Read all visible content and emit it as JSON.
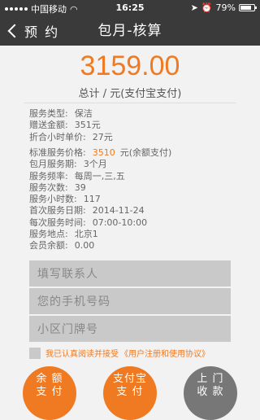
{
  "status_bar": {
    "carrier": "中国移动",
    "time": "16:25",
    "battery_text": "79%",
    "battery_level": 0.79
  },
  "nav": {
    "back_label": "预 约",
    "title": "包月-核算"
  },
  "amount": {
    "value": "3159.00",
    "subtitle": "总计 / 元(支付宝支付)"
  },
  "info_group1": [
    {
      "label": "服务类型:",
      "value": "保洁"
    },
    {
      "label": "赠送金额:",
      "value": "351元"
    },
    {
      "label": "折合小时单价:",
      "value": "27元"
    }
  ],
  "info_group2": [
    {
      "label": "标准服务价格:",
      "value": "3510",
      "suffix": "元(余额支付)"
    },
    {
      "label": "包月服务期:",
      "value": "3个月"
    },
    {
      "label": "服务频率:",
      "value": "每周一,三,五"
    },
    {
      "label": "服务次数:",
      "value": "39"
    },
    {
      "label": "服务小时数:",
      "value": "117"
    },
    {
      "label": "首次服务日期:",
      "value": "2014-11-24"
    },
    {
      "label": "每次服务时间:",
      "value": "07:00-10:00"
    },
    {
      "label": "服务地点:",
      "value": "北京1"
    },
    {
      "label": "会员余额:",
      "value": "0.00"
    }
  ],
  "form": {
    "contact_placeholder": "填写联系人",
    "phone_placeholder": "您的手机号码",
    "address_placeholder": "小区门牌号"
  },
  "agreement": {
    "text": "我已认真阅读并接受",
    "link": "《用户注册和使用协议》"
  },
  "buttons": {
    "balance_line1": "余 额",
    "balance_line2": "支 付",
    "alipay_line1": "支付宝",
    "alipay_line2": "支 付",
    "door_line1": "上 门",
    "door_line2": "收 款"
  },
  "colors": {
    "accent": "#f07a22",
    "bar": "#3a3a3a",
    "gray_button": "#777777"
  }
}
